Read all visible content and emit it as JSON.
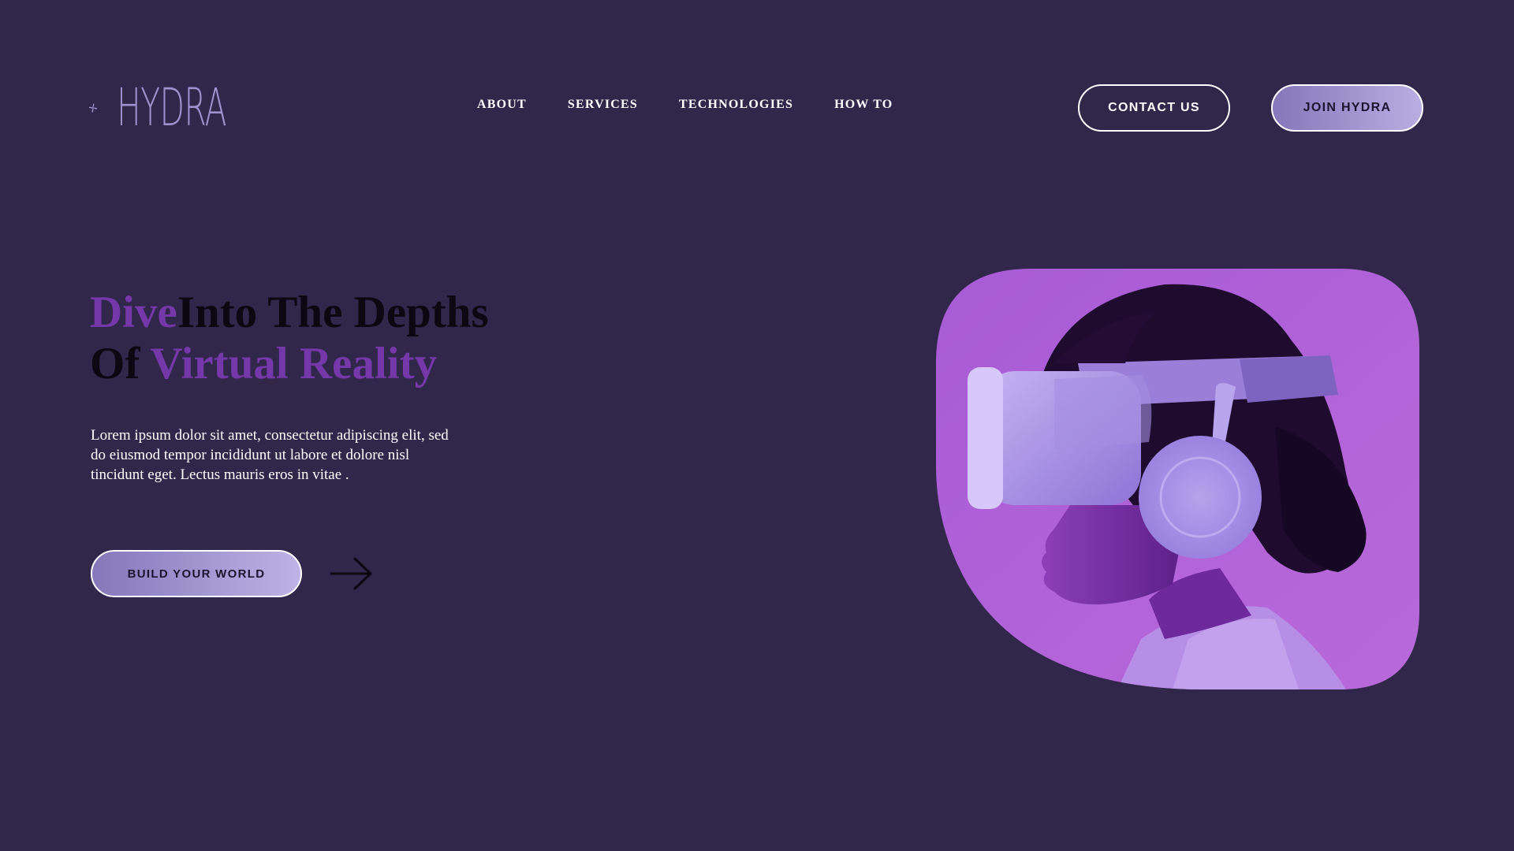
{
  "brand": {
    "name": "HYDRA",
    "logo_icon": "hydra-swirl-logo-icon",
    "color": "#9f91cc"
  },
  "nav": {
    "items": [
      {
        "label": "ABOUT"
      },
      {
        "label": "SERVICES"
      },
      {
        "label": "TECHNOLOGIES"
      },
      {
        "label": "HOW TO"
      }
    ]
  },
  "header": {
    "contact_label": "CONTACT US",
    "join_label": "JOIN HYDRA"
  },
  "hero": {
    "title_part1": "Dive",
    "title_part2": "Into The Depths",
    "title_part3": "Of ",
    "title_part4": "Virtual Reality",
    "description": "Lorem ipsum dolor sit amet, consectetur adipiscing elit, sed do eiusmod tempor incididunt ut labore et dolore nisl tincidunt eget. Lectus mauris eros in vitae .",
    "cta_label": "BUILD YOUR WORLD",
    "arrow_icon": "arrow-right-icon",
    "image": "person-wearing-vr-headset-and-headphones"
  },
  "colors": {
    "background": "#30274a",
    "accent": "#7438a8",
    "heading": "#0c0812",
    "button_gradient_start": "#8577b9",
    "button_gradient_end": "#b8aee2",
    "image_tint": "#a85ad8"
  }
}
